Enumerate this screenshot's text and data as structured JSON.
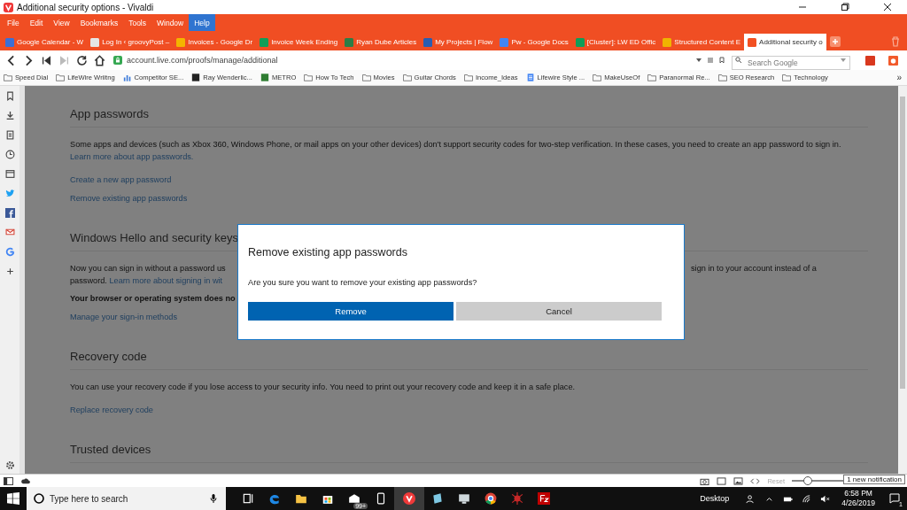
{
  "window": {
    "title": "Additional security options - Vivaldi"
  },
  "menu": [
    {
      "label": "File",
      "selected": false
    },
    {
      "label": "Edit",
      "selected": false
    },
    {
      "label": "View",
      "selected": false
    },
    {
      "label": "Bookmarks",
      "selected": false
    },
    {
      "label": "Tools",
      "selected": false
    },
    {
      "label": "Window",
      "selected": false
    },
    {
      "label": "Help",
      "selected": true
    }
  ],
  "tabs": [
    {
      "title": "Google Calendar - W",
      "selected": false
    },
    {
      "title": "Log In ‹ groovyPost –",
      "selected": false
    },
    {
      "title": "Invoices - Google Dr",
      "selected": false
    },
    {
      "title": "Invoice Week Ending",
      "selected": false
    },
    {
      "title": "Ryan Dube Articles",
      "selected": false
    },
    {
      "title": "My Projects | Flow",
      "selected": false
    },
    {
      "title": "Pw - Google Docs",
      "selected": false
    },
    {
      "title": "[Cluster]: LW ED Offic",
      "selected": false
    },
    {
      "title": "Structured Content E",
      "selected": false
    },
    {
      "title": "Additional security o",
      "selected": true
    }
  ],
  "address_bar": {
    "url": "account.live.com/proofs/manage/additional"
  },
  "search": {
    "placeholder": "Search Google"
  },
  "bookmarks": [
    {
      "label": "Speed Dial",
      "kind": "folder"
    },
    {
      "label": "LifeWire Wriitng",
      "kind": "folder"
    },
    {
      "label": "Competitor SE...",
      "kind": "chart"
    },
    {
      "label": "Ray Wenderlic...",
      "kind": "site"
    },
    {
      "label": "METRO",
      "kind": "site"
    },
    {
      "label": "How To Tech",
      "kind": "folder"
    },
    {
      "label": "Movies",
      "kind": "folder"
    },
    {
      "label": "Guitar Chords",
      "kind": "folder"
    },
    {
      "label": "Income_Ideas",
      "kind": "folder"
    },
    {
      "label": "Lifewire Style ...",
      "kind": "doc"
    },
    {
      "label": "MakeUseOf",
      "kind": "folder"
    },
    {
      "label": "Paranormal Re...",
      "kind": "folder"
    },
    {
      "label": "SEO Research",
      "kind": "folder"
    },
    {
      "label": "Technology",
      "kind": "folder"
    }
  ],
  "bookmarks_overflow": "»",
  "app_passwords": {
    "heading": "App passwords",
    "paragraph": "Some apps and devices (such as Xbox 360, Windows Phone, or mail apps on your other devices) don't support security codes for two-step verification. In these cases, you need to create an app password to sign in.",
    "paragraph_link": "Learn more about app passwords.",
    "links": [
      "Create a new app password",
      "Remove existing app passwords"
    ]
  },
  "windows_hello": {
    "heading": "Windows Hello and security keys",
    "line_1_left": "Now you can sign in without a password us",
    "line_1_right": "sign in to your account instead of a",
    "line_2_text": "password.",
    "line_2_link": "Learn more about signing in wit",
    "bold_note": "Your browser or operating system does no",
    "links": [
      "Manage your sign-in methods"
    ]
  },
  "recovery_code": {
    "heading": "Recovery code",
    "paragraph": "You can use your recovery code if you lose access to your security info. You need to print out your recovery code and keep it in a safe place.",
    "links": [
      "Replace recovery code"
    ]
  },
  "trusted_devices": {
    "heading": "Trusted devices"
  },
  "dialog": {
    "title": "Remove existing app passwords",
    "message": "Are you sure you want to remove your existing app passwords?",
    "buttons": [
      {
        "label": "Remove",
        "kind": "primary"
      },
      {
        "label": "Cancel",
        "kind": "secondary"
      }
    ]
  },
  "status_bar": {
    "reset": "Reset",
    "zoom": {
      "level": 0.3
    },
    "tooltip": "1 new notification"
  },
  "taskbar": {
    "search_placeholder": "Type here to search",
    "mail_badge": "99+",
    "desktop": "Desktop",
    "time": "6:58 PM",
    "date": "4/26/2019",
    "notifications": "1"
  }
}
